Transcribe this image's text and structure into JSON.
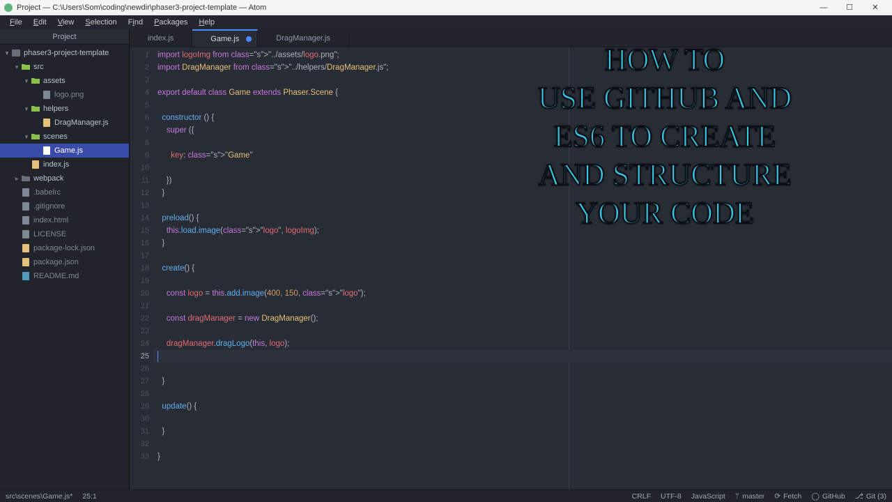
{
  "titlebar": {
    "title": "Project — C:\\Users\\Som\\coding\\newdir\\phaser3-project-template — Atom"
  },
  "win": {
    "min": "—",
    "max": "☐",
    "close": "✕"
  },
  "menu": [
    "File",
    "Edit",
    "View",
    "Selection",
    "Find",
    "Packages",
    "Help"
  ],
  "sidebar": {
    "heading": "Project",
    "project": "phaser3-project-template",
    "src": "src",
    "assets": "assets",
    "logo_png": "logo.png",
    "helpers": "helpers",
    "dragmanager_js": "DragManager.js",
    "scenes": "scenes",
    "game_js": "Game.js",
    "index_js": "index.js",
    "webpack": "webpack",
    "babelrc": ".babelrc",
    "gitignore": ".gitignore",
    "index_html": "index.html",
    "license": "LICENSE",
    "pkg_lock": "package-lock.json",
    "pkg": "package.json",
    "readme": "README.md"
  },
  "tabs": {
    "t1": "index.js",
    "t2": "Game.js",
    "t3": "DragManager.js"
  },
  "code": {
    "lines": 33,
    "raw": [
      "import logoImg from \"../assets/logo.png\";",
      "import DragManager from \"../helpers/DragManager.js\";",
      "",
      "export default class Game extends Phaser.Scene {",
      "",
      "  constructor () {",
      "    super ({",
      "",
      "      key: \"Game\"",
      "",
      "    })",
      "  }",
      "",
      "  preload() {",
      "    this.load.image(\"logo\", logoImg);",
      "  }",
      "",
      "  create() {",
      "",
      "    const logo = this.add.image(400, 150, \"logo\");",
      "",
      "    const dragManager = new DragManager();",
      "",
      "    dragManager.dragLogo(this, logo);",
      "",
      "",
      "  }",
      "",
      "  update() {",
      "",
      "  }",
      "",
      "}"
    ],
    "cursor_line": 25
  },
  "status": {
    "path": "src\\scenes\\Game.js*",
    "cursor": "25:1",
    "eol": "CRLF",
    "encoding": "UTF-8",
    "grammar": "JavaScript",
    "branch": "master",
    "fetch": "Fetch",
    "github": "GitHub",
    "git": "Git (3)"
  },
  "overlay": {
    "text": "HOW TO\nUSE GITHUB AND\nES6 TO CREATE\nAND STRUCTURE\nYOUR CODE"
  }
}
